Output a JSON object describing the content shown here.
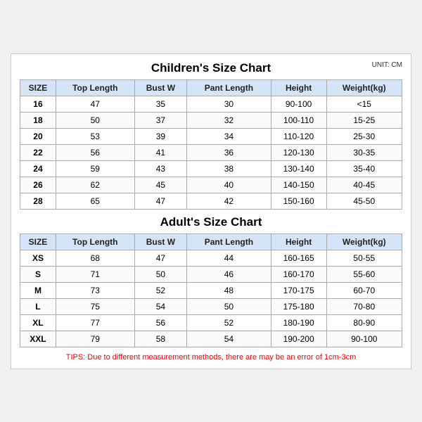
{
  "chart": {
    "unit": "UNIT: CM",
    "children": {
      "title": "Children's Size Chart",
      "headers": [
        "SIZE",
        "Top Length",
        "Bust W",
        "Pant Length",
        "Height",
        "Weight(kg)"
      ],
      "rows": [
        [
          "16",
          "47",
          "35",
          "30",
          "90-100",
          "<15"
        ],
        [
          "18",
          "50",
          "37",
          "32",
          "100-110",
          "15-25"
        ],
        [
          "20",
          "53",
          "39",
          "34",
          "110-120",
          "25-30"
        ],
        [
          "22",
          "56",
          "41",
          "36",
          "120-130",
          "30-35"
        ],
        [
          "24",
          "59",
          "43",
          "38",
          "130-140",
          "35-40"
        ],
        [
          "26",
          "62",
          "45",
          "40",
          "140-150",
          "40-45"
        ],
        [
          "28",
          "65",
          "47",
          "42",
          "150-160",
          "45-50"
        ]
      ]
    },
    "adults": {
      "title": "Adult's Size Chart",
      "headers": [
        "SIZE",
        "Top Length",
        "Bust W",
        "Pant Length",
        "Height",
        "Weight(kg)"
      ],
      "rows": [
        [
          "XS",
          "68",
          "47",
          "44",
          "160-165",
          "50-55"
        ],
        [
          "S",
          "71",
          "50",
          "46",
          "160-170",
          "55-60"
        ],
        [
          "M",
          "73",
          "52",
          "48",
          "170-175",
          "60-70"
        ],
        [
          "L",
          "75",
          "54",
          "50",
          "175-180",
          "70-80"
        ],
        [
          "XL",
          "77",
          "56",
          "52",
          "180-190",
          "80-90"
        ],
        [
          "XXL",
          "79",
          "58",
          "54",
          "190-200",
          "90-100"
        ]
      ]
    },
    "tips": "TIPS: Due to different measurement methods, there are may be an error of 1cm-3cm"
  }
}
